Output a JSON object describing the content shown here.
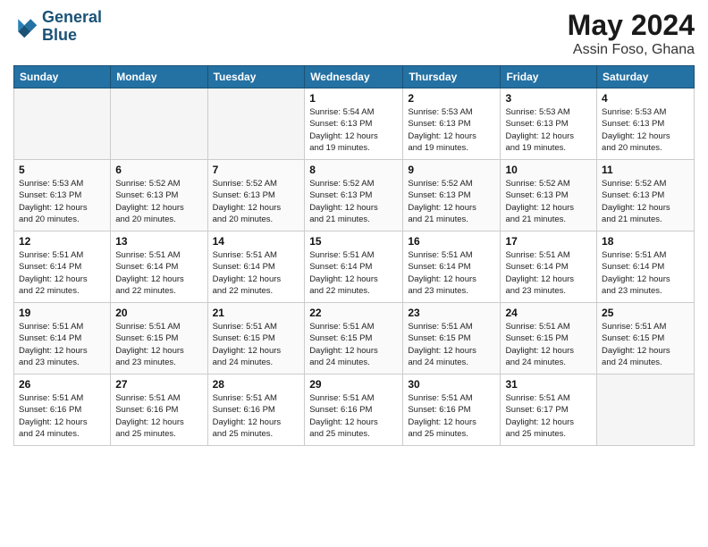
{
  "logo": {
    "line1": "General",
    "line2": "Blue"
  },
  "title": "May 2024",
  "location": "Assin Foso, Ghana",
  "days_of_week": [
    "Sunday",
    "Monday",
    "Tuesday",
    "Wednesday",
    "Thursday",
    "Friday",
    "Saturday"
  ],
  "weeks": [
    [
      {
        "day": "",
        "info": ""
      },
      {
        "day": "",
        "info": ""
      },
      {
        "day": "",
        "info": ""
      },
      {
        "day": "1",
        "info": "Sunrise: 5:54 AM\nSunset: 6:13 PM\nDaylight: 12 hours\nand 19 minutes."
      },
      {
        "day": "2",
        "info": "Sunrise: 5:53 AM\nSunset: 6:13 PM\nDaylight: 12 hours\nand 19 minutes."
      },
      {
        "day": "3",
        "info": "Sunrise: 5:53 AM\nSunset: 6:13 PM\nDaylight: 12 hours\nand 19 minutes."
      },
      {
        "day": "4",
        "info": "Sunrise: 5:53 AM\nSunset: 6:13 PM\nDaylight: 12 hours\nand 20 minutes."
      }
    ],
    [
      {
        "day": "5",
        "info": "Sunrise: 5:53 AM\nSunset: 6:13 PM\nDaylight: 12 hours\nand 20 minutes."
      },
      {
        "day": "6",
        "info": "Sunrise: 5:52 AM\nSunset: 6:13 PM\nDaylight: 12 hours\nand 20 minutes."
      },
      {
        "day": "7",
        "info": "Sunrise: 5:52 AM\nSunset: 6:13 PM\nDaylight: 12 hours\nand 20 minutes."
      },
      {
        "day": "8",
        "info": "Sunrise: 5:52 AM\nSunset: 6:13 PM\nDaylight: 12 hours\nand 21 minutes."
      },
      {
        "day": "9",
        "info": "Sunrise: 5:52 AM\nSunset: 6:13 PM\nDaylight: 12 hours\nand 21 minutes."
      },
      {
        "day": "10",
        "info": "Sunrise: 5:52 AM\nSunset: 6:13 PM\nDaylight: 12 hours\nand 21 minutes."
      },
      {
        "day": "11",
        "info": "Sunrise: 5:52 AM\nSunset: 6:13 PM\nDaylight: 12 hours\nand 21 minutes."
      }
    ],
    [
      {
        "day": "12",
        "info": "Sunrise: 5:51 AM\nSunset: 6:14 PM\nDaylight: 12 hours\nand 22 minutes."
      },
      {
        "day": "13",
        "info": "Sunrise: 5:51 AM\nSunset: 6:14 PM\nDaylight: 12 hours\nand 22 minutes."
      },
      {
        "day": "14",
        "info": "Sunrise: 5:51 AM\nSunset: 6:14 PM\nDaylight: 12 hours\nand 22 minutes."
      },
      {
        "day": "15",
        "info": "Sunrise: 5:51 AM\nSunset: 6:14 PM\nDaylight: 12 hours\nand 22 minutes."
      },
      {
        "day": "16",
        "info": "Sunrise: 5:51 AM\nSunset: 6:14 PM\nDaylight: 12 hours\nand 23 minutes."
      },
      {
        "day": "17",
        "info": "Sunrise: 5:51 AM\nSunset: 6:14 PM\nDaylight: 12 hours\nand 23 minutes."
      },
      {
        "day": "18",
        "info": "Sunrise: 5:51 AM\nSunset: 6:14 PM\nDaylight: 12 hours\nand 23 minutes."
      }
    ],
    [
      {
        "day": "19",
        "info": "Sunrise: 5:51 AM\nSunset: 6:14 PM\nDaylight: 12 hours\nand 23 minutes."
      },
      {
        "day": "20",
        "info": "Sunrise: 5:51 AM\nSunset: 6:15 PM\nDaylight: 12 hours\nand 23 minutes."
      },
      {
        "day": "21",
        "info": "Sunrise: 5:51 AM\nSunset: 6:15 PM\nDaylight: 12 hours\nand 24 minutes."
      },
      {
        "day": "22",
        "info": "Sunrise: 5:51 AM\nSunset: 6:15 PM\nDaylight: 12 hours\nand 24 minutes."
      },
      {
        "day": "23",
        "info": "Sunrise: 5:51 AM\nSunset: 6:15 PM\nDaylight: 12 hours\nand 24 minutes."
      },
      {
        "day": "24",
        "info": "Sunrise: 5:51 AM\nSunset: 6:15 PM\nDaylight: 12 hours\nand 24 minutes."
      },
      {
        "day": "25",
        "info": "Sunrise: 5:51 AM\nSunset: 6:15 PM\nDaylight: 12 hours\nand 24 minutes."
      }
    ],
    [
      {
        "day": "26",
        "info": "Sunrise: 5:51 AM\nSunset: 6:16 PM\nDaylight: 12 hours\nand 24 minutes."
      },
      {
        "day": "27",
        "info": "Sunrise: 5:51 AM\nSunset: 6:16 PM\nDaylight: 12 hours\nand 25 minutes."
      },
      {
        "day": "28",
        "info": "Sunrise: 5:51 AM\nSunset: 6:16 PM\nDaylight: 12 hours\nand 25 minutes."
      },
      {
        "day": "29",
        "info": "Sunrise: 5:51 AM\nSunset: 6:16 PM\nDaylight: 12 hours\nand 25 minutes."
      },
      {
        "day": "30",
        "info": "Sunrise: 5:51 AM\nSunset: 6:16 PM\nDaylight: 12 hours\nand 25 minutes."
      },
      {
        "day": "31",
        "info": "Sunrise: 5:51 AM\nSunset: 6:17 PM\nDaylight: 12 hours\nand 25 minutes."
      },
      {
        "day": "",
        "info": ""
      }
    ]
  ]
}
